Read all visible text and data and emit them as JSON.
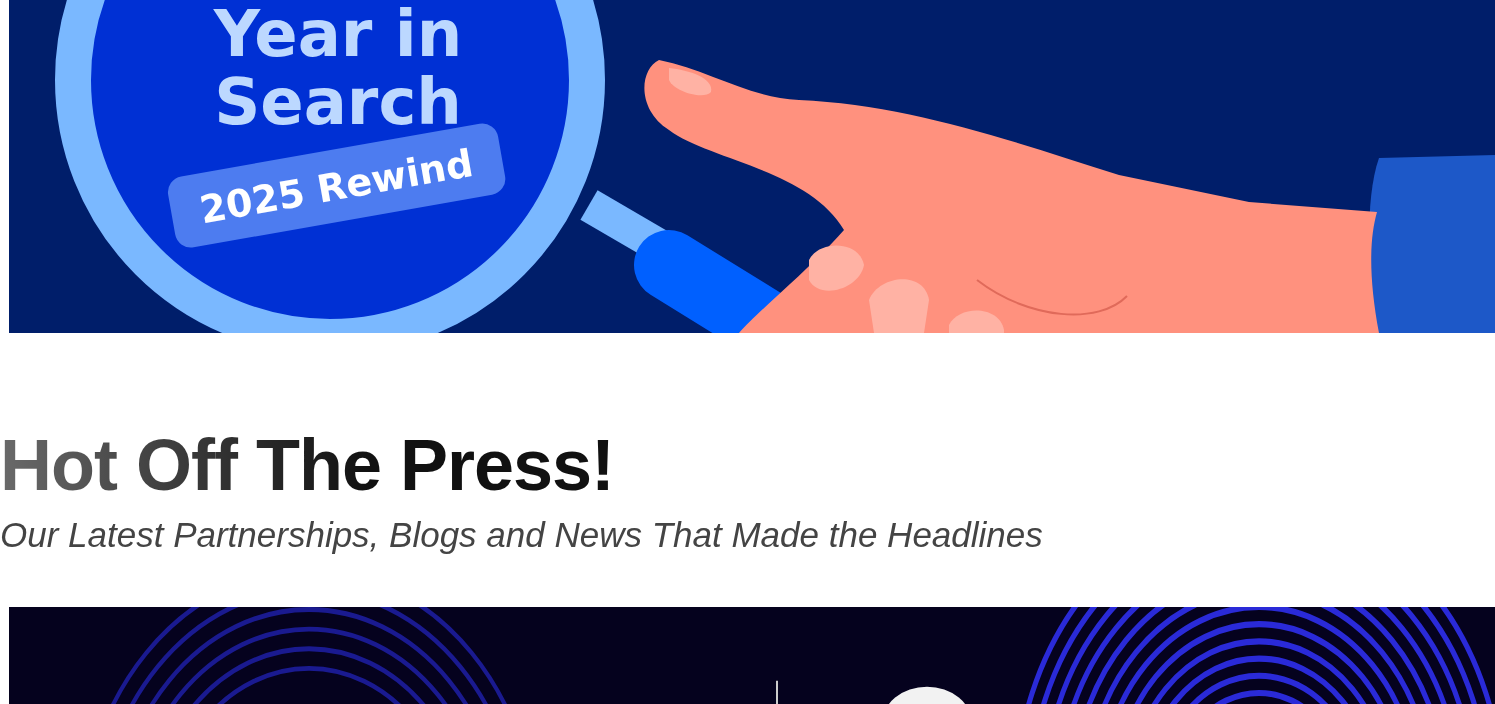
{
  "banner": {
    "kind": "illustration",
    "title_lines": [
      "Year in",
      "Search"
    ],
    "badge": "2025 Rewind"
  },
  "section": {
    "heading": "Hot Off The Press!",
    "subheading": "Our Latest Partnerships, Blogs and News That Made the Headlines"
  }
}
